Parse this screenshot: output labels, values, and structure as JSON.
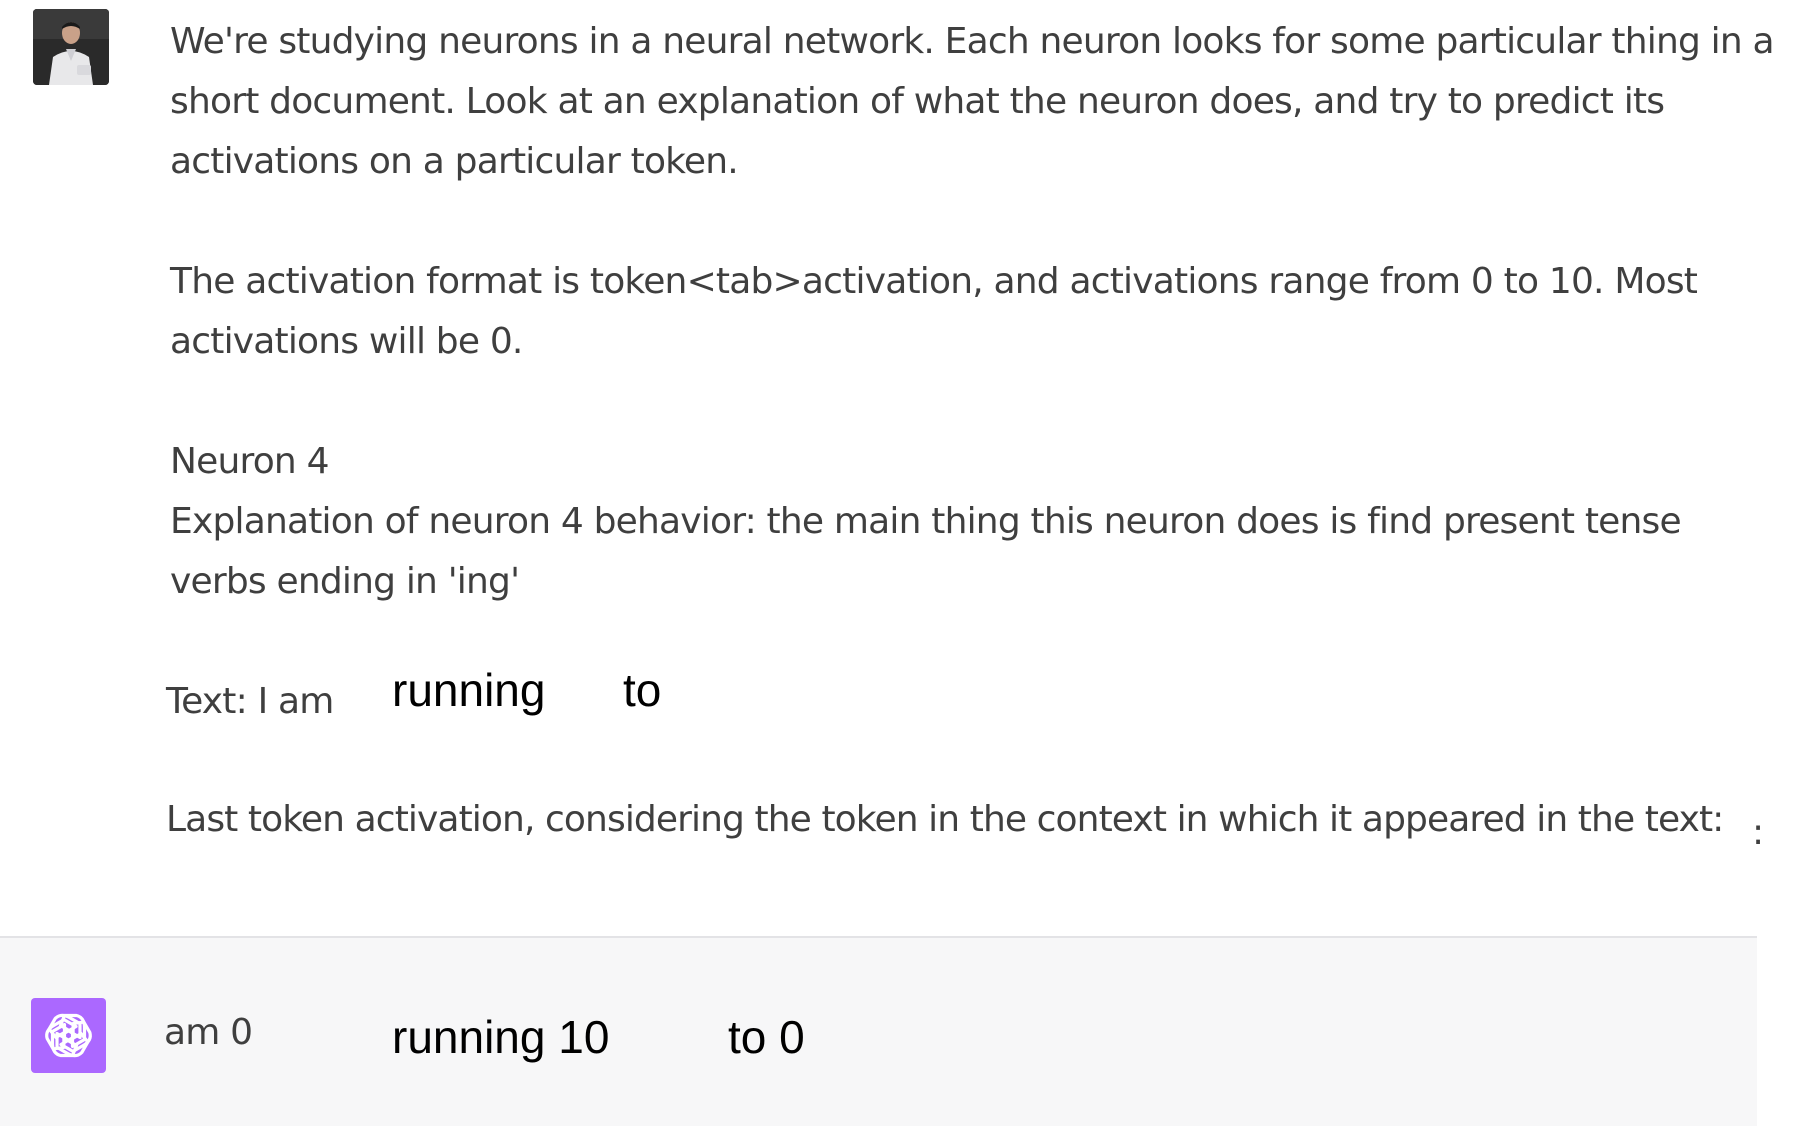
{
  "user_message": {
    "paragraph_1": [
      "We're studying neurons in a neural network. Each neuron looks for some particular thing in a",
      "short document. Look at  an explanation of what the neuron does, and try to predict its",
      "activations on a particular token."
    ],
    "paragraph_2": [
      "The activation format is token<tab>activation, and activations range from 0 to 10. Most",
      "activations will be 0."
    ],
    "paragraph_3": [
      "Neuron 4",
      "Explanation of neuron 4 behavior: the main thing this neuron does is find present tense",
      "verbs ending in 'ing'"
    ],
    "text_label": "Text: I am",
    "text_tokens": [
      "running",
      "to"
    ],
    "last_token_line": "Last token activation, considering the token in the context in which it appeared in the text:",
    "trailing_colon": ":"
  },
  "assistant_message": {
    "lead": "am 0",
    "tokens": [
      "running 10",
      "to 0"
    ]
  },
  "colors": {
    "assistant_avatar": "#ab68ff",
    "assistant_background": "#f7f7f8",
    "body_text": "#3f3f3f"
  },
  "icons": {
    "user_avatar": "user-photo-avatar",
    "assistant_avatar": "openai-logo-icon"
  }
}
